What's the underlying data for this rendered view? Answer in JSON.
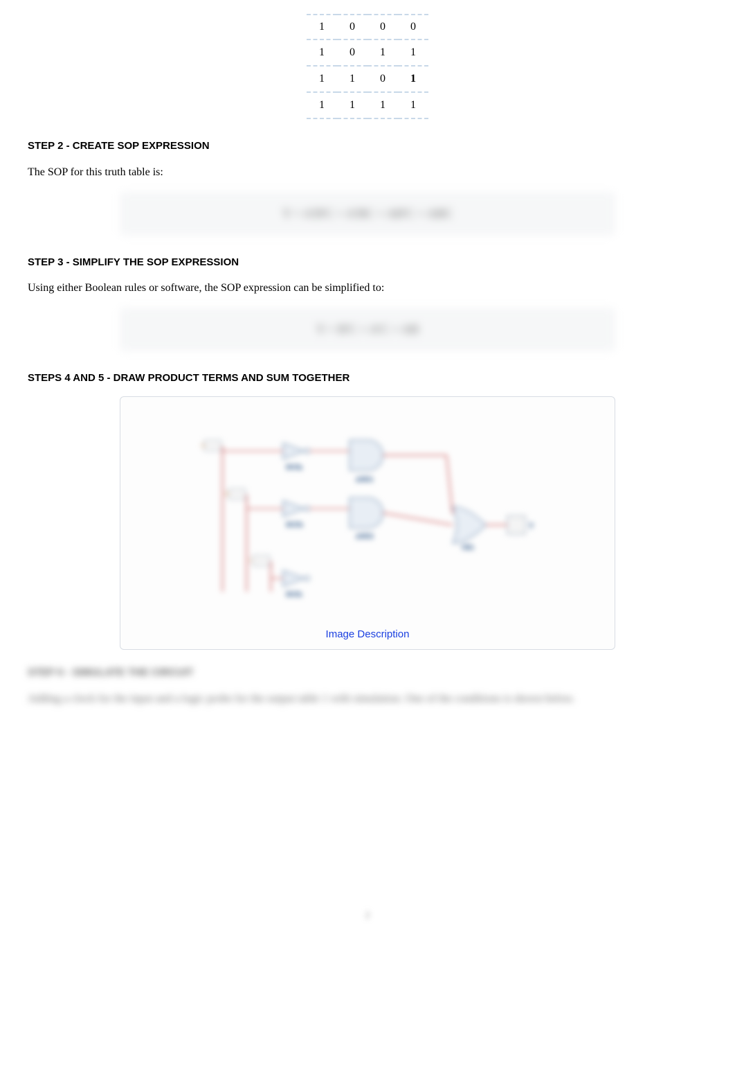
{
  "truth_table": {
    "rows": [
      [
        "1",
        "0",
        "0",
        "0"
      ],
      [
        "1",
        "0",
        "1",
        "1"
      ],
      [
        "1",
        "1",
        "0",
        "1"
      ],
      [
        "1",
        "1",
        "1",
        "1"
      ]
    ],
    "bold_cells": [
      [
        2,
        3
      ]
    ]
  },
  "step2": {
    "heading": "STEP 2 - CREATE SOP EXPRESSION",
    "text": "The SOP for this truth table is:",
    "formula": "Y = A'B'C + A'BC + AB'C + ABC"
  },
  "step3": {
    "heading": "STEP 3 - SIMPLIFY THE SOP EXPRESSION",
    "text": "Using either Boolean rules or software, the SOP expression can be simplified to:",
    "formula": "Y = B'C + A'C + AB"
  },
  "step4_5": {
    "heading": "STEPS 4 AND 5 - DRAW PRODUCT TERMS AND SUM TOGETHER",
    "image_description_label": "Image Description"
  },
  "step6": {
    "heading": "STEP 6 - SIMULATE THE CIRCUIT",
    "text": "Adding a clock for the input and a logic probe for the output table 1 with simulation. One of the conditions is shown below."
  },
  "page_number": "2"
}
